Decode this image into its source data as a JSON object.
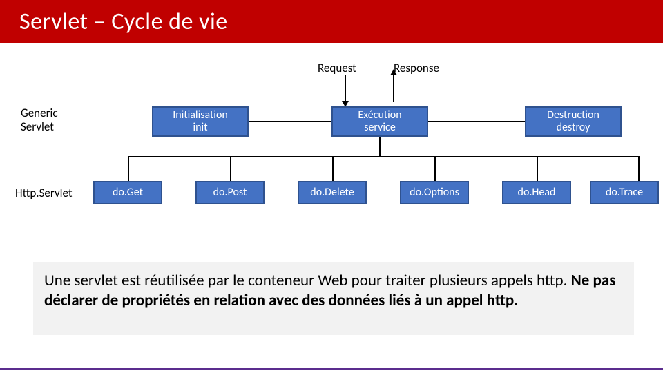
{
  "header": {
    "title": "Servlet – Cycle de vie"
  },
  "labels": {
    "request": "Request",
    "response": "Response",
    "generic_line1": "Generic",
    "generic_line2": "Servlet",
    "http": "Http.Servlet"
  },
  "phases": {
    "init_line1": "Initialisation",
    "init_line2": "init",
    "exec_line1": "Exécution",
    "exec_line2": "service",
    "destroy_line1": "Destruction",
    "destroy_line2": "destroy"
  },
  "methods": {
    "doGet": "do.Get",
    "doPost": "do.Post",
    "doDelete": "do.Delete",
    "doOptions": "do.Options",
    "doHead": "do.Head",
    "doTrace": "do.Trace"
  },
  "note": {
    "part1": "Une servlet est réutilisée par le conteneur Web pour traiter plusieurs appels http. ",
    "bold": "Ne pas déclarer de propriétés en relation avec des données liés à un appel http.",
    "part2": ""
  }
}
